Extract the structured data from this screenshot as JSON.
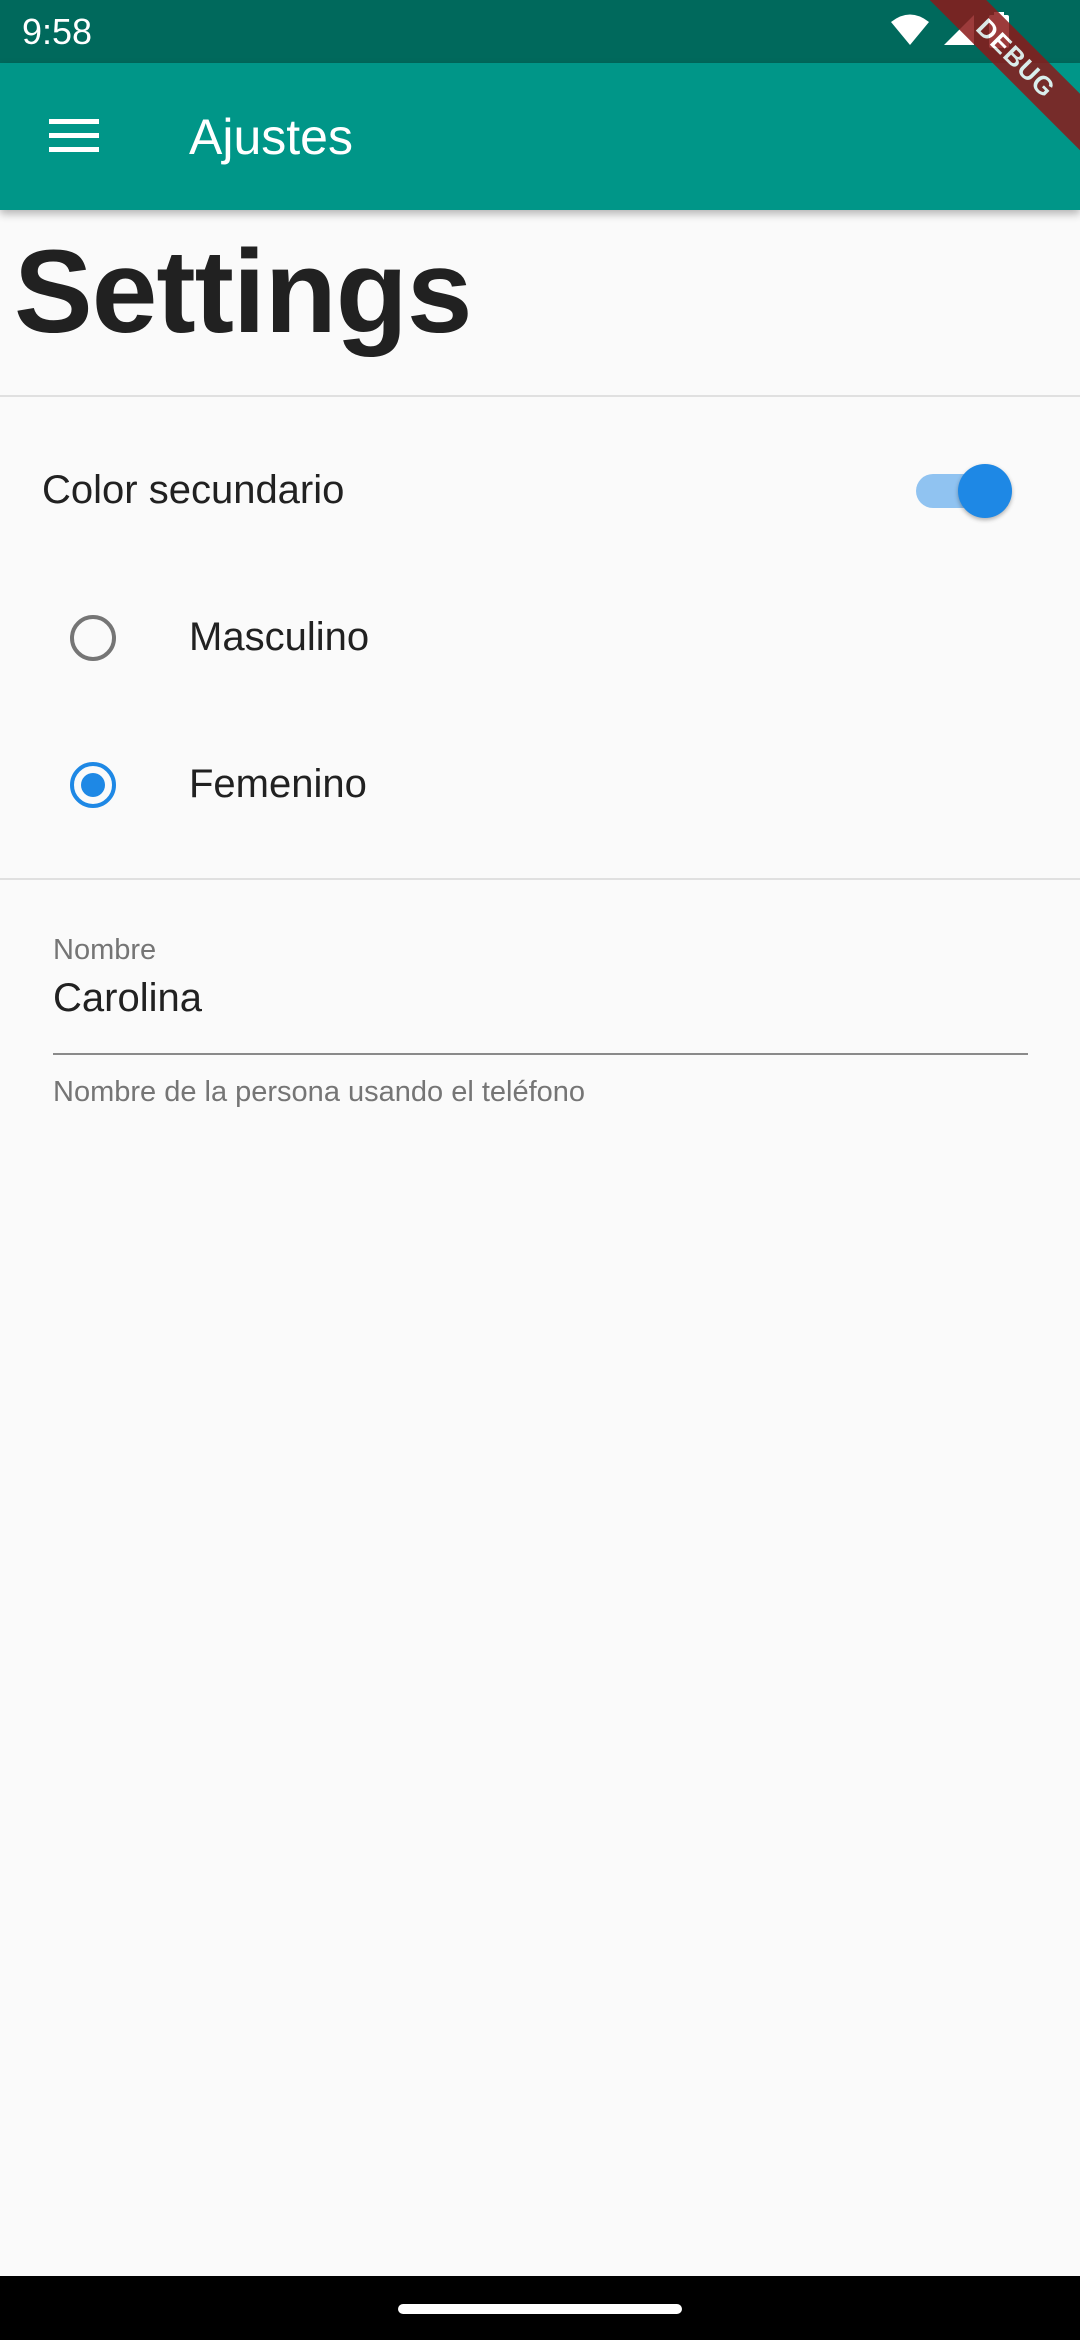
{
  "status_bar": {
    "time": "9:58",
    "icons": [
      "wifi-icon",
      "signal-icon",
      "battery-icon"
    ]
  },
  "app_bar": {
    "title": "Ajustes",
    "menu_icon": "menu-icon",
    "background_color": "#009688"
  },
  "debug_banner": {
    "label": "DEBUG"
  },
  "page": {
    "heading": "Settings"
  },
  "settings": {
    "secondary_color": {
      "label": "Color secundario",
      "enabled": true,
      "accent_color": "#1e88e5"
    },
    "gender": {
      "options": [
        {
          "label": "Masculino",
          "selected": false
        },
        {
          "label": "Femenino",
          "selected": true
        }
      ]
    },
    "name_field": {
      "label": "Nombre",
      "value": "Carolina",
      "helper_text": "Nombre de la persona usando el teléfono"
    }
  }
}
